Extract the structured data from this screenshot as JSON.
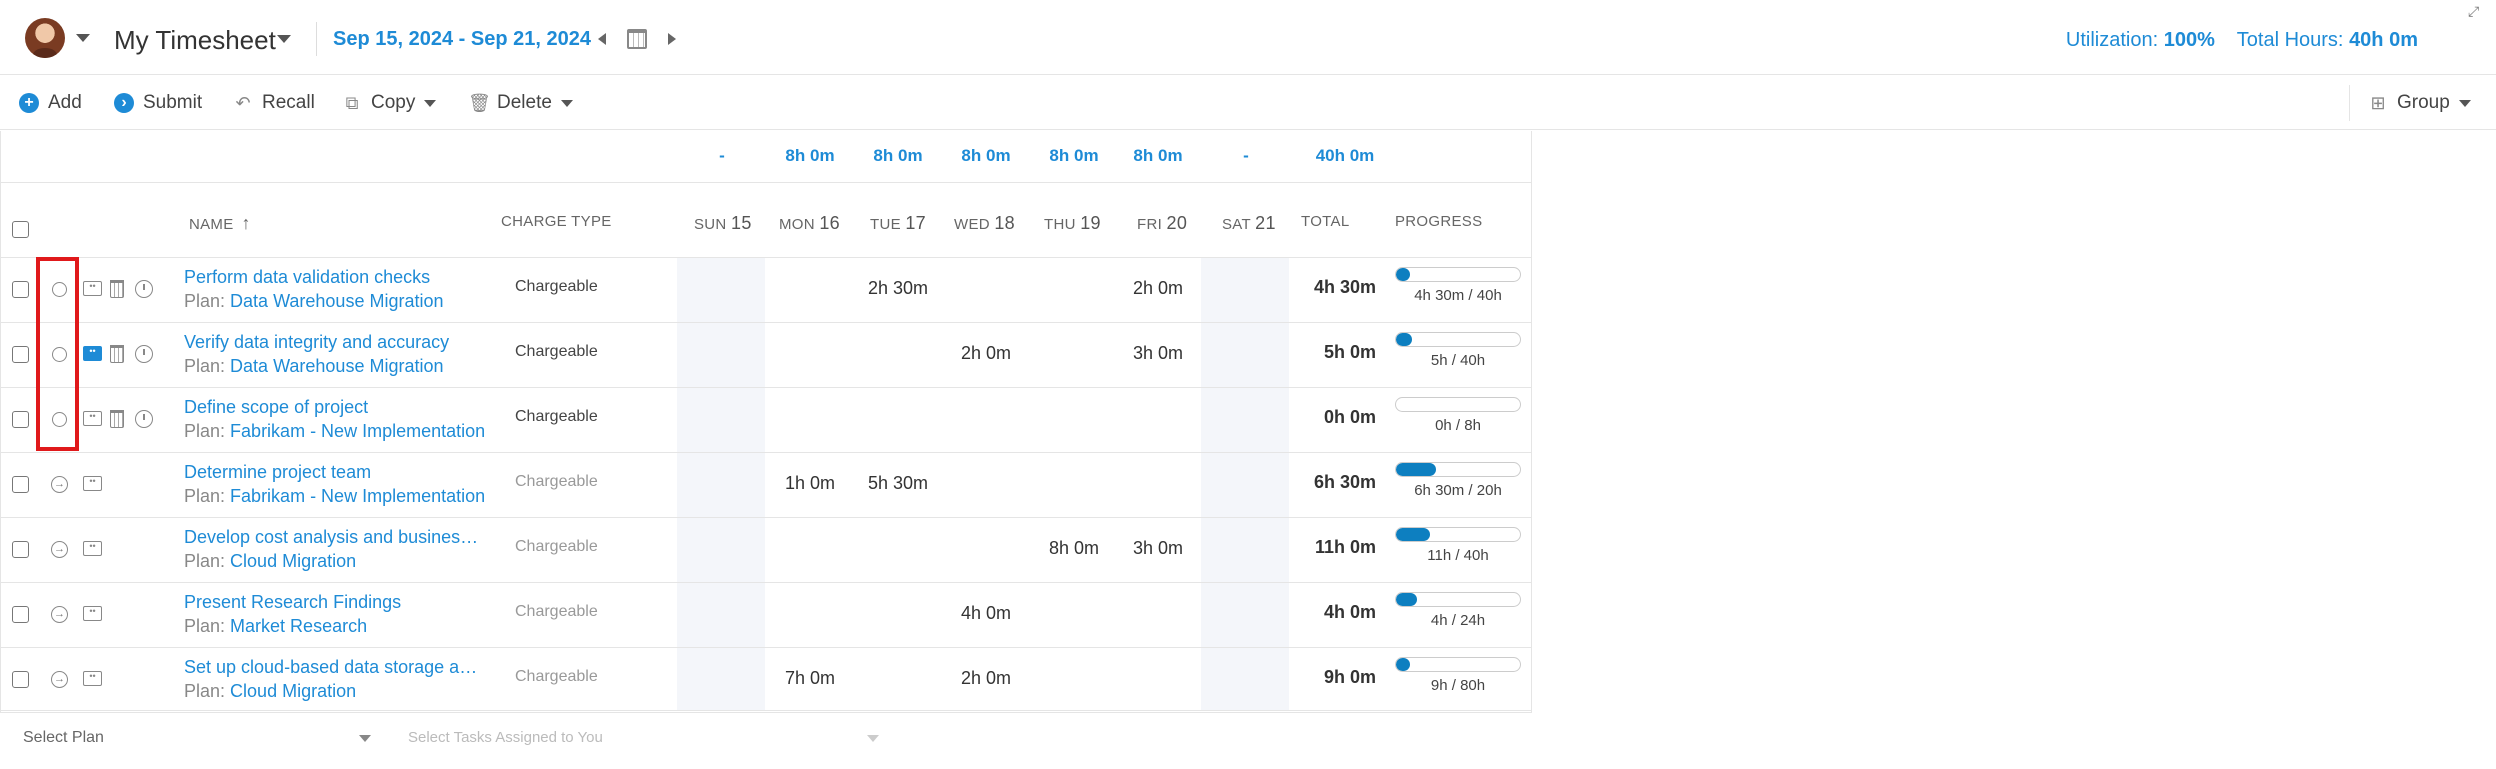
{
  "header": {
    "title": "My Timesheet",
    "date_range": "Sep 15, 2024 - Sep 21, 2024",
    "utilization_label": "Utilization:",
    "utilization_value": "100%",
    "total_hours_label": "Total Hours:",
    "total_hours_value": "40h 0m"
  },
  "toolbar": {
    "add": "Add",
    "submit": "Submit",
    "recall": "Recall",
    "copy": "Copy",
    "delete": "Delete",
    "group": "Group"
  },
  "totals": [
    "-",
    "8h 0m",
    "8h 0m",
    "8h 0m",
    "8h 0m",
    "8h 0m",
    "-",
    "40h 0m"
  ],
  "columns": {
    "name": "NAME",
    "charge_type": "CHARGE TYPE",
    "days": [
      {
        "dow": "SUN",
        "num": "15"
      },
      {
        "dow": "MON",
        "num": "16"
      },
      {
        "dow": "TUE",
        "num": "17"
      },
      {
        "dow": "WED",
        "num": "18"
      },
      {
        "dow": "THU",
        "num": "19"
      },
      {
        "dow": "FRI",
        "num": "20"
      },
      {
        "dow": "SAT",
        "num": "21"
      }
    ],
    "total": "TOTAL",
    "progress": "PROGRESS"
  },
  "rows": [
    {
      "name": "Perform data validation checks",
      "plan_label": "Plan:",
      "plan": "Data Warehouse Migration",
      "charge": "Chargeable",
      "days": [
        "",
        "",
        "2h 30m",
        "",
        "",
        "2h 0m",
        ""
      ],
      "total": "4h 30m",
      "progress_text": "4h 30m / 40h",
      "progress": 0.11
    },
    {
      "name": "Verify data integrity and accuracy",
      "plan_label": "Plan:",
      "plan": "Data Warehouse Migration",
      "charge": "Chargeable",
      "days": [
        "",
        "",
        "",
        "2h 0m",
        "",
        "3h 0m",
        ""
      ],
      "total": "5h 0m",
      "progress_text": "5h / 40h",
      "progress": 0.13
    },
    {
      "name": "Define scope of project",
      "plan_label": "Plan:",
      "plan": "Fabrikam - New Implementation",
      "charge": "Chargeable",
      "days": [
        "",
        "",
        "",
        "",
        "",
        "",
        ""
      ],
      "total": "0h 0m",
      "progress_text": "0h / 8h",
      "progress": 0
    },
    {
      "name": "Determine project team",
      "plan_label": "Plan:",
      "plan": "Fabrikam - New Implementation",
      "charge": "Chargeable",
      "days": [
        "",
        "1h 0m",
        "5h 30m",
        "",
        "",
        "",
        ""
      ],
      "total": "6h 30m",
      "progress_text": "6h 30m / 20h",
      "progress": 0.325
    },
    {
      "name": "Develop cost analysis and business ...",
      "plan_label": "Plan:",
      "plan": "Cloud Migration",
      "charge": "Chargeable",
      "days": [
        "",
        "",
        "",
        "",
        "8h 0m",
        "3h 0m",
        ""
      ],
      "total": "11h 0m",
      "progress_text": "11h / 40h",
      "progress": 0.275
    },
    {
      "name": "Present Research Findings",
      "plan_label": "Plan:",
      "plan": "Market Research",
      "charge": "Chargeable",
      "days": [
        "",
        "",
        "",
        "4h 0m",
        "",
        "",
        ""
      ],
      "total": "4h 0m",
      "progress_text": "4h / 24h",
      "progress": 0.167
    },
    {
      "name": "Set up cloud-based data storage an...",
      "plan_label": "Plan:",
      "plan": "Cloud Migration",
      "charge": "Chargeable",
      "days": [
        "",
        "7h 0m",
        "",
        "2h 0m",
        "",
        "",
        ""
      ],
      "total": "9h 0m",
      "progress_text": "9h / 80h",
      "progress": 0.1125
    }
  ],
  "footer": {
    "select_plan": "Select Plan",
    "select_tasks": "Select Tasks Assigned to You"
  },
  "colors": {
    "accent": "#1e8bd6",
    "progress": "#0d7fc0",
    "highlight": "#e0191b"
  }
}
